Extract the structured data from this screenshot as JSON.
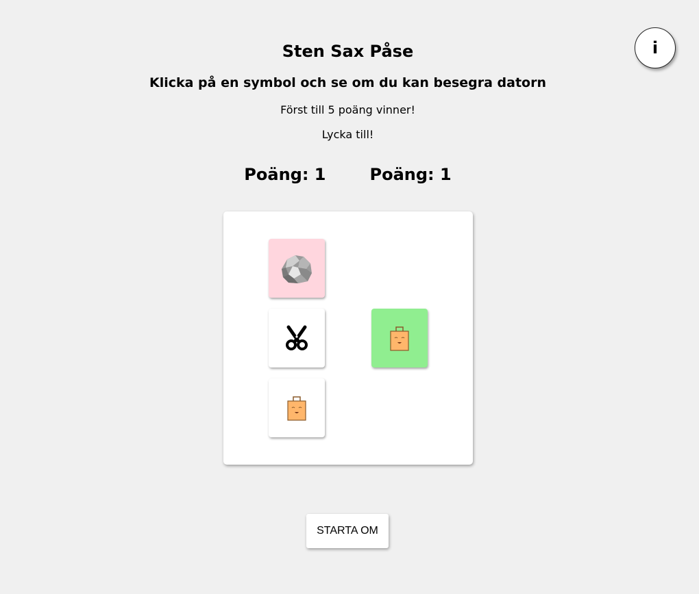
{
  "title": "Sten Sax Påse",
  "subtitle": "Klicka på en symbol och se om du kan besegra datorn",
  "instructions": {
    "line1": "Först till 5 poäng vinner!",
    "line2": "Lycka till!"
  },
  "info_button": {
    "label": "i"
  },
  "scores": {
    "player": "Poäng: 1",
    "computer": "Poäng: 1"
  },
  "player_choices": [
    {
      "name": "rock",
      "icon": "rock-icon",
      "selected": true,
      "highlight_color": "#ffd6de"
    },
    {
      "name": "scissors",
      "icon": "scissors-icon",
      "selected": false
    },
    {
      "name": "bag",
      "icon": "bag-icon",
      "selected": false
    }
  ],
  "computer_choice": {
    "name": "bag",
    "icon": "bag-icon",
    "highlight_color": "#90ee90"
  },
  "restart_button": {
    "label": "STARTA OM"
  }
}
